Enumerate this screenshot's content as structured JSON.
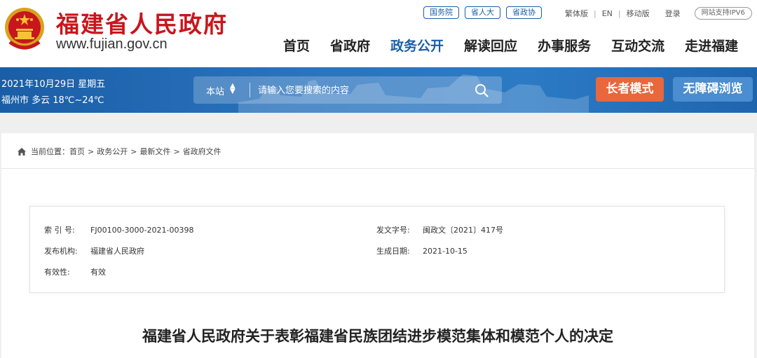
{
  "header": {
    "site_name": "福建省人民政府",
    "site_url": "www.fujian.gov.cn",
    "top_links": [
      "国务院",
      "省人大",
      "省政协"
    ],
    "util_links": [
      "繁体版",
      "EN",
      "移动版"
    ],
    "login": "登录",
    "ipv6": "网站支持IPV6",
    "nav": [
      "首页",
      "省政府",
      "政务公开",
      "解读回应",
      "办事服务",
      "互动交流",
      "走进福建"
    ],
    "active_nav": "政务公开"
  },
  "band": {
    "date": "2021年10月29日 星期五",
    "weather": "福州市 多云 18℃~24℃",
    "search_scope": "本站",
    "search_placeholder": "请输入您要搜索的内容",
    "elder_mode": "长者模式",
    "accessible": "无障碍浏览"
  },
  "breadcrumb": {
    "label": "当前位置：",
    "items": [
      "首页",
      "政务公开",
      "最新文件",
      "省政府文件"
    ]
  },
  "meta": {
    "index_no_label": "索 引 号:",
    "index_no": "FJ00100-3000-2021-00398",
    "doc_no_label": "发文字号:",
    "doc_no": "闽政文〔2021〕417号",
    "issuer_label": "发布机构:",
    "issuer": "福建省人民政府",
    "date_label": "生成日期:",
    "date": "2021-10-15",
    "validity_label": "有效性:",
    "validity": "有效"
  },
  "doc_title": "福建省人民政府关于表彰福建省民族团结进步模范集体和模范个人的决定",
  "colors": {
    "brand_red": "#c8161d",
    "brand_blue": "#1a5fa8",
    "elder_button": "#e8673c",
    "access_button": "#4a8dd0"
  }
}
